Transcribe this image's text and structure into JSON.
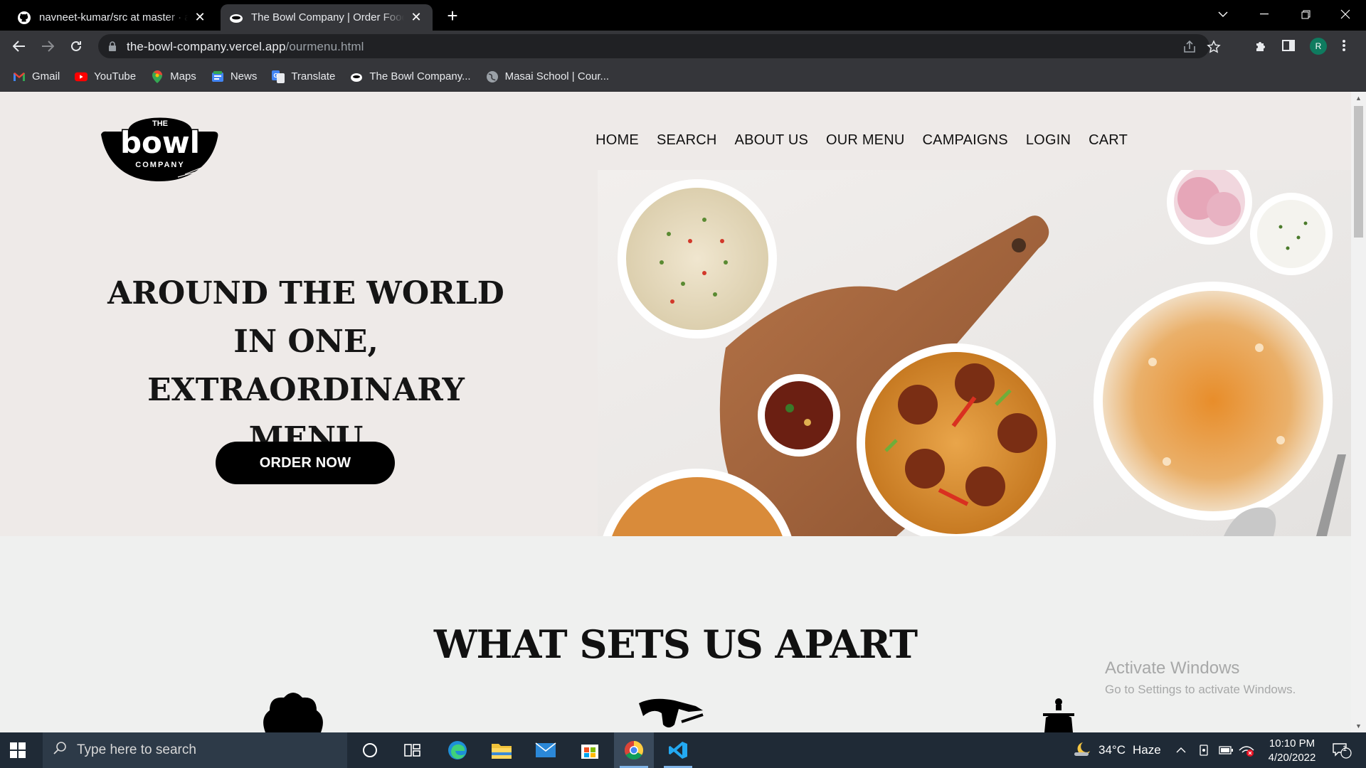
{
  "browser": {
    "tabs": [
      {
        "title": "navneet-kumar/src at master · anas",
        "active": false
      },
      {
        "title": "The Bowl Company | Order Food Online",
        "active": true
      }
    ],
    "new_tab": "+",
    "address": {
      "domain": "the-bowl-company.vercel.app",
      "path": "/ourmenu.html"
    },
    "profile_initial": "R",
    "bookmarks": [
      {
        "label": "Gmail",
        "icon": "gmail-icon"
      },
      {
        "label": "YouTube",
        "icon": "youtube-icon"
      },
      {
        "label": "Maps",
        "icon": "maps-icon"
      },
      {
        "label": "News",
        "icon": "news-icon"
      },
      {
        "label": "Translate",
        "icon": "translate-icon"
      },
      {
        "label": "The Bowl Company...",
        "icon": "bowl-icon"
      },
      {
        "label": "Masai School | Cour...",
        "icon": "globe-icon"
      }
    ]
  },
  "site": {
    "logo": {
      "top": "THE",
      "word": "bowl",
      "bottom": "COMPANY"
    },
    "nav": [
      "HOME",
      "SEARCH",
      "ABOUT US",
      "OUR MENU",
      "CAMPAIGNS",
      "LOGIN",
      "CART"
    ],
    "hero": {
      "line1": "AROUND THE WORLD",
      "line2": "IN ONE,",
      "line3": "EXTRAORDINARY MENU",
      "cta": "ORDER NOW"
    },
    "section_title": "WHAT SETS US APART"
  },
  "watermark": {
    "title": "Activate Windows",
    "subtitle": "Go to Settings to activate Windows."
  },
  "taskbar": {
    "search_placeholder": "Type here to search",
    "weather": {
      "temp": "34°C",
      "condition": "Haze"
    },
    "time": "10:10 PM",
    "date": "4/20/2022",
    "notification_count": "1"
  }
}
